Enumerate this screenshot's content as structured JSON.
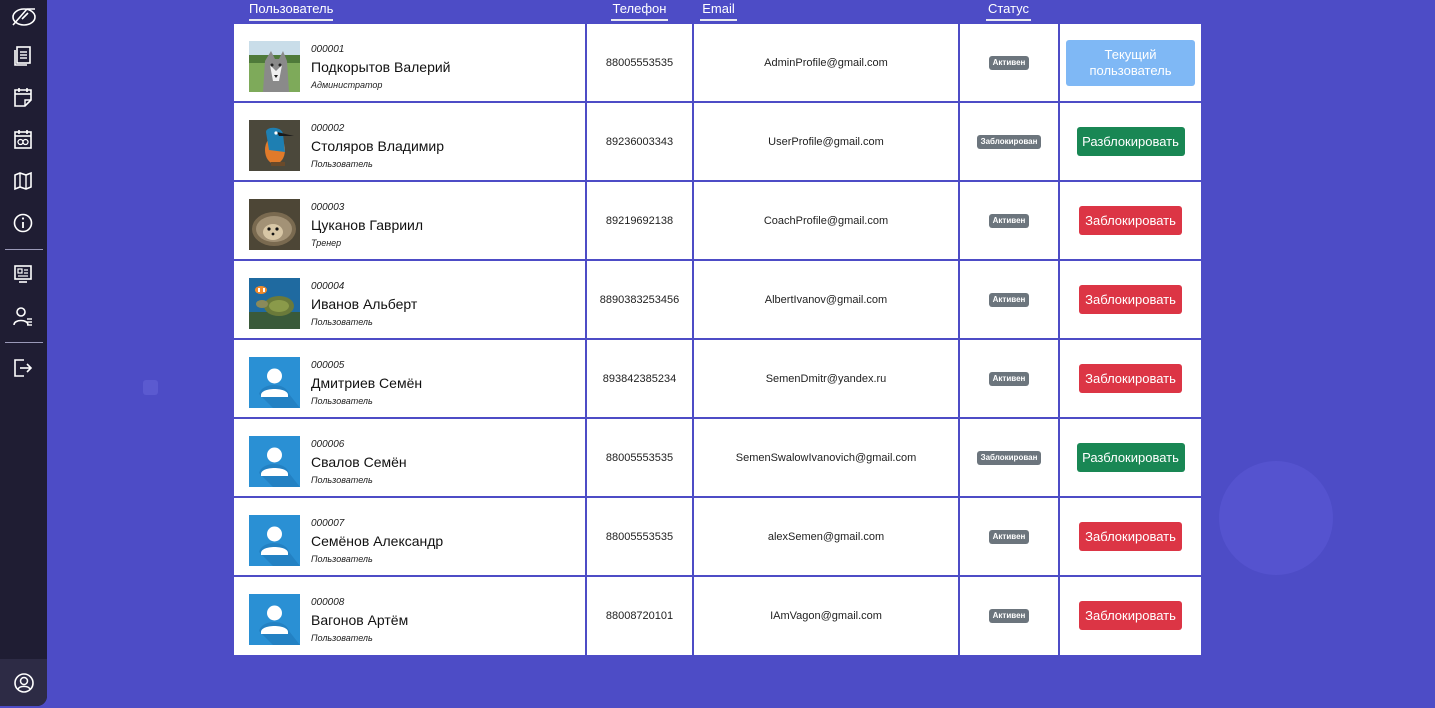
{
  "headers": {
    "user": "Пользователь",
    "phone": "Телефон",
    "email": "Email",
    "status": "Статус"
  },
  "sidebar": {
    "icons": [
      "logo-icon",
      "document-icon",
      "notepad-icon",
      "calendar-icon",
      "map-icon",
      "info-icon",
      "monitor-icon",
      "users-settings-icon",
      "logout-icon",
      "profile-icon"
    ]
  },
  "users": [
    {
      "id": "000001",
      "name": "Подкорытов Валерий",
      "role": "Администратор",
      "phone": "88005553535",
      "email": "AdminProfile@gmail.com",
      "status": "Активен",
      "action": "Текущий пользователь",
      "action_type": "current",
      "avatar": "husky"
    },
    {
      "id": "000002",
      "name": "Столяров Владимир",
      "role": "Пользователь",
      "phone": "89236003343",
      "email": "UserProfile@gmail.com",
      "status": "Заблокирован",
      "action": "Разблокировать",
      "action_type": "unblock",
      "avatar": "bird"
    },
    {
      "id": "000003",
      "name": "Цуканов Гавриил",
      "role": "Тренер",
      "phone": "89219692138",
      "email": "CoachProfile@gmail.com",
      "status": "Активен",
      "action": "Заблокировать",
      "action_type": "block",
      "avatar": "hedgehog"
    },
    {
      "id": "000004",
      "name": "Иванов Альберт",
      "role": "Пользователь",
      "phone": "8890383253456",
      "email": "AlbertIvanov@gmail.com",
      "status": "Активен",
      "action": "Заблокировать",
      "action_type": "block",
      "avatar": "turtle"
    },
    {
      "id": "000005",
      "name": "Дмитриев Семён",
      "role": "Пользователь",
      "phone": "893842385234",
      "email": "SemenDmitr@yandex.ru",
      "status": "Активен",
      "action": "Заблокировать",
      "action_type": "block",
      "avatar": "default"
    },
    {
      "id": "000006",
      "name": "Свалов Семён",
      "role": "Пользователь",
      "phone": "88005553535",
      "email": "SemenSwalowIvanovich@gmail.com",
      "status": "Заблокирован",
      "action": "Разблокировать",
      "action_type": "unblock",
      "avatar": "default"
    },
    {
      "id": "000007",
      "name": "Семёнов Александр",
      "role": "Пользователь",
      "phone": "88005553535",
      "email": "alexSemen@gmail.com",
      "status": "Активен",
      "action": "Заблокировать",
      "action_type": "block",
      "avatar": "default"
    },
    {
      "id": "000008",
      "name": "Вагонов Артём",
      "role": "Пользователь",
      "phone": "88008720101",
      "email": "IAmVagon@gmail.com",
      "status": "Активен",
      "action": "Заблокировать",
      "action_type": "block",
      "avatar": "default"
    }
  ],
  "colors": {
    "background": "#4d4cc6",
    "sidebar": "#1f1d33",
    "badge": "#6c757d",
    "current": "#7fb8f5",
    "unblock": "#198754",
    "block": "#dc3545"
  }
}
